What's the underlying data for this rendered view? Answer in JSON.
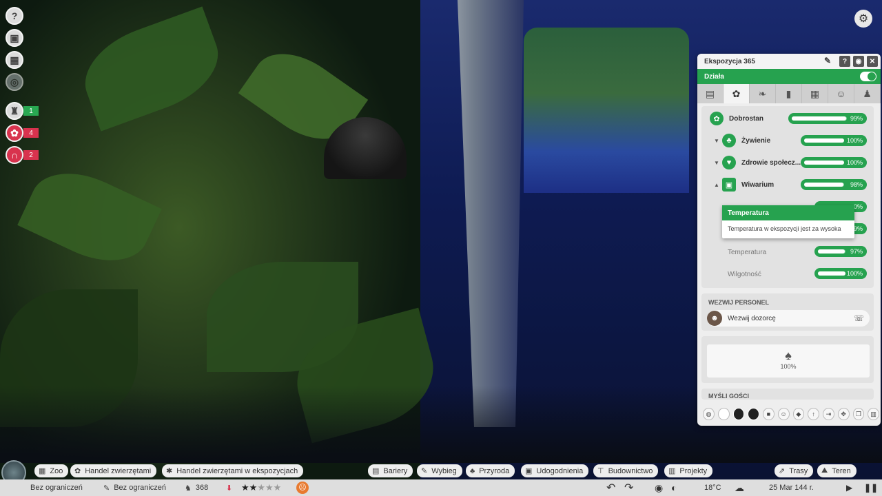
{
  "left_rail": {
    "help_icon": "question-icon",
    "zoopedia_icon": "book-icon",
    "calendar_icon": "calendar-icon",
    "hidden_icon": "gear-dim-icon",
    "staff_count": "1",
    "animals_count": "4",
    "habitats_count": "2",
    "colors": {
      "green": "#29a852",
      "red": "#d8334e"
    }
  },
  "panel": {
    "title": "Ekspozycja 365",
    "header_buttons": [
      "?",
      "◉",
      "✕"
    ],
    "toggle_label": "Działa",
    "tabs": [
      "clipboard-icon",
      "paw-icon",
      "leaf-icon",
      "thermometer-icon",
      "exhibit-icon",
      "keeper-icon",
      "staff-icon"
    ],
    "stats": [
      {
        "label": "Dobrostan",
        "value": "99%",
        "fill": 0.99
      },
      {
        "label": "Żywienie",
        "value": "100%",
        "fill": 1.0
      },
      {
        "label": "Zdrowie społecz...",
        "value": "100%",
        "fill": 1.0
      },
      {
        "label": "Wiwarium",
        "value": "98%",
        "fill": 0.98
      },
      {
        "label": "Temperatura",
        "value": "97%",
        "fill": 0.97
      },
      {
        "label": "Wilgotność",
        "value": "100%",
        "fill": 1.0
      }
    ],
    "hidden_bars": [
      {
        "value": "0%",
        "fill": 1.0
      },
      {
        "value": "9%",
        "fill": 1.0
      }
    ],
    "tooltip": {
      "title": "Temperatura",
      "text": "Temperatura w ekspozycji jest za wysoka"
    },
    "staff_section_title": "WEZWIJ PERSONEL",
    "call_keeper": "Wezwij dozorcę",
    "environment_value": "100%",
    "thoughts_title": "MYŚLI GOŚCI",
    "accent": "#26a24f"
  },
  "toolbar": {
    "left": [
      "Zoo",
      "Handel zwierzętami",
      "Handel zwierzętami w ekspozycjach"
    ],
    "middle": [
      "Bariery",
      "Wybieg",
      "Przyroda",
      "Udogodnienia",
      "Budownictwo",
      "Projekty"
    ],
    "right": [
      "Trasy",
      "Teren"
    ]
  },
  "status": {
    "funding": "Bez ograniczeń",
    "research": "Bez ograniczeń",
    "guests": "368",
    "rating_stars": 2,
    "rating_max": 5,
    "temperature": "18°C",
    "date": "25 Mar 144 r."
  }
}
